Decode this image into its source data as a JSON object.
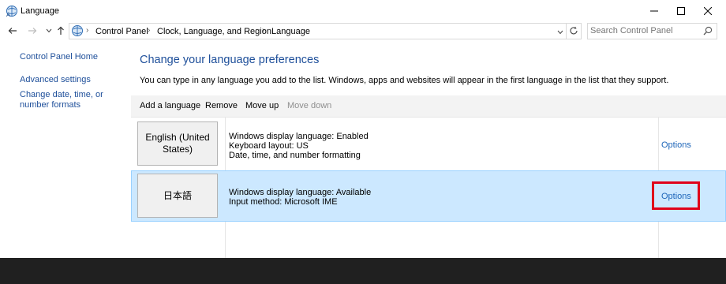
{
  "window": {
    "title": "Language",
    "controls": {
      "minimize": "—",
      "maximize": "☐",
      "close": "✕"
    }
  },
  "nav": {
    "back_icon": "arrow-left-icon",
    "forward_icon": "arrow-right-icon",
    "recent_icon": "chevron-down-icon",
    "up_icon": "arrow-up-icon"
  },
  "address": {
    "crumbs": [
      "Control Panel",
      "Clock, Language, and Region",
      "Language"
    ],
    "search_placeholder": "Search Control Panel"
  },
  "sidebar": {
    "items": [
      {
        "label": "Control Panel Home"
      },
      {
        "label": "Advanced settings"
      },
      {
        "label": "Change date, time, or number formats"
      }
    ]
  },
  "main": {
    "heading": "Change your language preferences",
    "description": "You can type in any language you add to the list. Windows, apps and websites will appear in the first language in the list that they support.",
    "toolbar": {
      "add": "Add a language",
      "remove": "Remove",
      "move_up": "Move up",
      "move_down": "Move down"
    },
    "languages": [
      {
        "name": "English (United States)",
        "details": [
          "Windows display language: Enabled",
          "Keyboard layout: US",
          "Date, time, and number formatting"
        ],
        "options": "Options"
      },
      {
        "name": "日本語",
        "details": [
          "Windows display language: Available",
          "Input method: Microsoft IME"
        ],
        "options": "Options"
      }
    ]
  },
  "colors": {
    "link": "#1e4f9a",
    "selection": "#cce8ff",
    "highlight_box": "#e0001a",
    "taskbar": "#202020"
  }
}
